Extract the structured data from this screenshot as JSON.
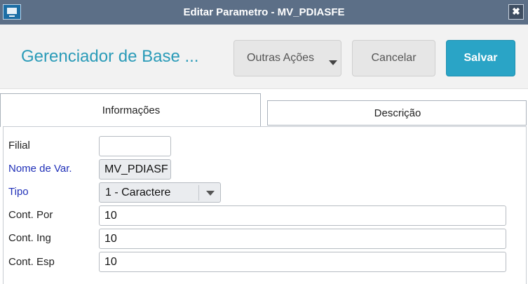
{
  "window": {
    "title": "Editar Parametro - MV_PDIASFE",
    "close_glyph": "✖"
  },
  "header": {
    "page_title": "Gerenciador de Base ...",
    "outras_acoes_label": "Outras Ações",
    "cancelar_label": "Cancelar",
    "salvar_label": "Salvar"
  },
  "tabs": [
    {
      "label": "Informações",
      "active": true
    },
    {
      "label": "Descrição",
      "active": false
    }
  ],
  "form": {
    "filial": {
      "label": "Filial",
      "value": ""
    },
    "nome_var": {
      "label": "Nome de Var.",
      "value": "MV_PDIASF"
    },
    "tipo": {
      "label": "Tipo",
      "value": "1 - Caractere"
    },
    "cont_por": {
      "label": "Cont. Por",
      "value": "10"
    },
    "cont_ing": {
      "label": "Cont. Ing",
      "value": "10"
    },
    "cont_esp": {
      "label": "Cont. Esp",
      "value": "10"
    }
  },
  "colors": {
    "title_bar": "#5c6f87",
    "accent": "#2aa4c6",
    "page_title": "#2a9bb8",
    "required_label": "#2030b8"
  },
  "icons": {
    "app": "window-app-icon",
    "close": "close-icon",
    "dropdown": "chevron-down-icon"
  }
}
